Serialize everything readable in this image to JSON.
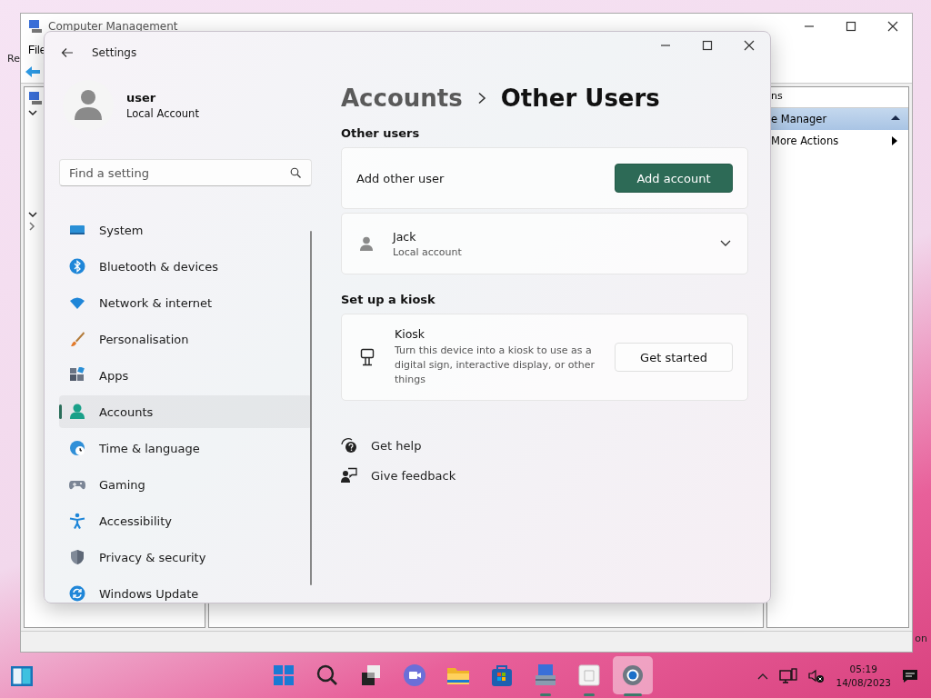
{
  "desktop": {
    "icon_labels": [
      "Re",
      "on"
    ]
  },
  "background_window": {
    "title": "Computer Management",
    "menu": [
      "File"
    ],
    "actions_header": "ns",
    "actions": [
      {
        "label": "e Manager",
        "selected": true,
        "kind": "collapse"
      },
      {
        "label": "More Actions",
        "selected": false,
        "kind": "submenu"
      }
    ]
  },
  "settings": {
    "title": "Settings",
    "user": {
      "name": "user",
      "account_type": "Local Account"
    },
    "search": {
      "placeholder": "Find a setting"
    },
    "nav": [
      {
        "label": "System",
        "kind": "system",
        "selected": false
      },
      {
        "label": "Bluetooth & devices",
        "kind": "bluetooth",
        "selected": false
      },
      {
        "label": "Network & internet",
        "kind": "network",
        "selected": false
      },
      {
        "label": "Personalisation",
        "kind": "brush",
        "selected": false
      },
      {
        "label": "Apps",
        "kind": "apps",
        "selected": false
      },
      {
        "label": "Accounts",
        "kind": "accounts",
        "selected": true
      },
      {
        "label": "Time & language",
        "kind": "time",
        "selected": false
      },
      {
        "label": "Gaming",
        "kind": "gaming",
        "selected": false
      },
      {
        "label": "Accessibility",
        "kind": "accessibility",
        "selected": false
      },
      {
        "label": "Privacy & security",
        "kind": "privacy",
        "selected": false
      },
      {
        "label": "Windows Update",
        "kind": "update",
        "selected": false
      }
    ],
    "breadcrumb": {
      "parent": "Accounts",
      "current": "Other Users"
    },
    "sections": [
      {
        "heading": "Other users",
        "cards": [
          {
            "kind": "action",
            "label": "Add other user",
            "button": "Add account"
          },
          {
            "kind": "user",
            "name": "Jack",
            "description": "Local account",
            "expanded": false
          }
        ]
      },
      {
        "heading": "Set up a kiosk",
        "cards": [
          {
            "kind": "kiosk",
            "name": "Kiosk",
            "description": "Turn this device into a kiosk to use as a digital sign, interactive display, or other things",
            "button": "Get started"
          }
        ]
      }
    ],
    "links": [
      {
        "kind": "help",
        "label": "Get help"
      },
      {
        "kind": "feedback",
        "label": "Give feedback"
      }
    ]
  },
  "taskbar": {
    "apps": [
      {
        "kind": "start",
        "selected": false,
        "running": false
      },
      {
        "kind": "search",
        "selected": false,
        "running": false
      },
      {
        "kind": "taskview",
        "selected": false,
        "running": false
      },
      {
        "kind": "chat",
        "selected": false,
        "running": false
      },
      {
        "kind": "explorer",
        "selected": false,
        "running": false
      },
      {
        "kind": "store",
        "selected": false,
        "running": false
      },
      {
        "kind": "management",
        "selected": false,
        "running": true
      },
      {
        "kind": "notepad",
        "selected": false,
        "running": true
      },
      {
        "kind": "settings",
        "selected": true,
        "running": true
      }
    ],
    "clock": {
      "time": "05:19",
      "date": "14/08/2023"
    }
  }
}
